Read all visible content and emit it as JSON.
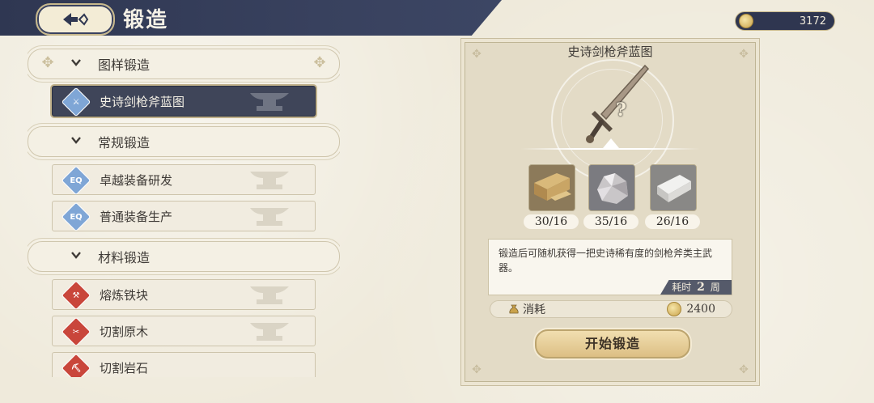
{
  "header": {
    "title": "锻造",
    "back_icon": "back-arrow-icon",
    "currency_value": "3172",
    "currency_icon": "coin-icon"
  },
  "categories": [
    {
      "label": "图样锻造",
      "items": [
        {
          "label": "史诗剑枪斧蓝图",
          "icon": "blueprint-icon",
          "selected": true
        }
      ]
    },
    {
      "label": "常规锻造",
      "items": [
        {
          "label": "卓越装备研发",
          "icon": "equipment-icon"
        },
        {
          "label": "普通装备生产",
          "icon": "equipment-icon"
        }
      ]
    },
    {
      "label": "材料锻造",
      "items": [
        {
          "label": "熔炼铁块",
          "icon": "smelt-icon"
        },
        {
          "label": "切割原木",
          "icon": "cut-wood-icon"
        },
        {
          "label": "切割岩石",
          "icon": "cut-stone-icon"
        }
      ]
    }
  ],
  "detail": {
    "title": "史诗剑枪斧蓝图",
    "item_icon": "sword-icon",
    "unknown_mark": "?",
    "materials": [
      {
        "name_icon": "wood-icon",
        "count": "30/16"
      },
      {
        "name_icon": "ore-icon",
        "count": "35/16"
      },
      {
        "name_icon": "iron-ingot-icon",
        "count": "26/16"
      }
    ],
    "description": "锻造后可随机获得一把史诗稀有度的剑枪斧类主武器。",
    "time_label": "耗时",
    "time_value": "2",
    "time_unit": "周",
    "cost_label": "消耗",
    "cost_value": "2400",
    "start_button": "开始锻造"
  }
}
